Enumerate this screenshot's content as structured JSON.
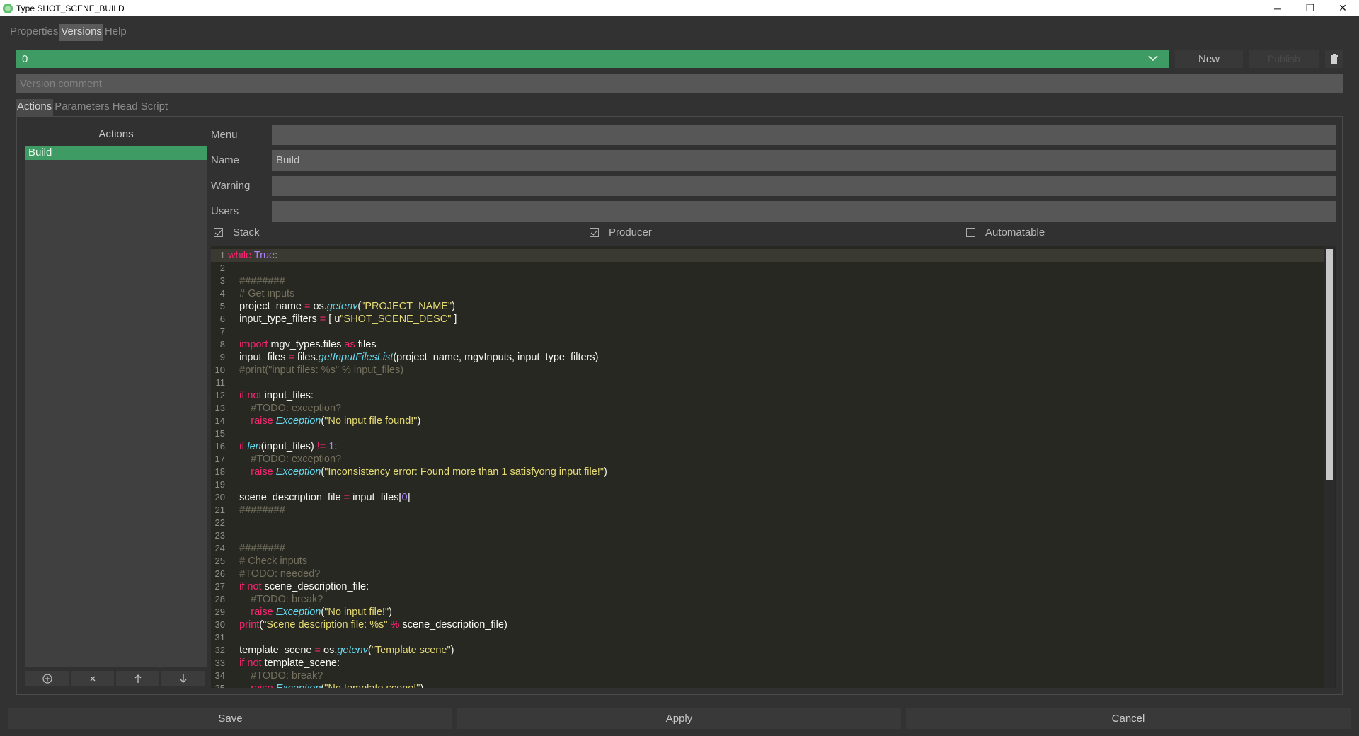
{
  "window": {
    "title": "Type SHOT_SCENE_BUILD",
    "minimize": "─",
    "restore": "❐",
    "close": "✕"
  },
  "menu": [
    {
      "label": "Properties",
      "active": false
    },
    {
      "label": "Versions",
      "active": true
    },
    {
      "label": "Help",
      "active": false
    }
  ],
  "version": {
    "selected": "0",
    "new_label": "New",
    "publish_label": "Publish",
    "comment_placeholder": "Version comment"
  },
  "tabs": [
    {
      "label": "Actions",
      "active": true
    },
    {
      "label": "Parameters",
      "active": false
    },
    {
      "label": "Head Script",
      "active": false
    }
  ],
  "actions": {
    "title": "Actions",
    "items": [
      "Build"
    ],
    "selected": "Build"
  },
  "form": {
    "menu_label": "Menu",
    "menu_value": "",
    "name_label": "Name",
    "name_value": "Build",
    "warning_label": "Warning",
    "warning_value": "",
    "users_label": "Users",
    "users_value": ""
  },
  "checks": {
    "stack": {
      "label": "Stack",
      "checked": true
    },
    "producer": {
      "label": "Producer",
      "checked": true
    },
    "automatable": {
      "label": "Automatable",
      "checked": false
    }
  },
  "code": {
    "current_line": 1,
    "lines": [
      "<span class=\"kw\">while</span> <span class=\"cst\">True</span>:",
      "",
      "    <span class=\"cm\">########</span>",
      "    <span class=\"cm\"># Get inputs</span>",
      "    project_name <span class=\"kw\">=</span> os.<span class=\"fn\">getenv</span>(<span class=\"str\">\"PROJECT_NAME\"</span>)",
      "    input_type_filters <span class=\"kw\">=</span> [ u<span class=\"str\">\"SHOT_SCENE_DESC\"</span> ]",
      "",
      "    <span class=\"kw\">import</span> mgv_types.files <span class=\"kw\">as</span> files",
      "    input_files <span class=\"kw\">=</span> files.<span class=\"fn\">getInputFilesList</span>(project_name, mgvInputs, input_type_filters)",
      "    <span class=\"cm\">#print(\"input files: %s\" % input_files)</span>",
      "",
      "    <span class=\"kw\">if not</span> input_files:",
      "        <span class=\"cm\">#TODO: exception?</span>",
      "        <span class=\"kw\">raise</span> <span class=\"fn\">Exception</span>(<span class=\"str\">\"No input file found!\"</span>)",
      "",
      "    <span class=\"kw\">if</span> <span class=\"fn\">len</span>(input_files) <span class=\"kw\">!=</span> <span class=\"cst\">1</span>:",
      "        <span class=\"cm\">#TODO: exception?</span>",
      "        <span class=\"kw\">raise</span> <span class=\"fn\">Exception</span>(<span class=\"str\">\"Inconsistency error: Found more than 1 satisfyong input file!\"</span>)",
      "",
      "    scene_description_file <span class=\"kw\">=</span> input_files[<span class=\"cst\">0</span>]",
      "    <span class=\"cm\">########</span>",
      "",
      "",
      "    <span class=\"cm\">########</span>",
      "    <span class=\"cm\"># Check inputs</span>",
      "    <span class=\"cm\">#TODO: needed?</span>",
      "    <span class=\"kw\">if not</span> scene_description_file:",
      "        <span class=\"cm\">#TODO: break?</span>",
      "        <span class=\"kw\">raise</span> <span class=\"fn\">Exception</span>(<span class=\"str\">\"No input file!\"</span>)",
      "    <span class=\"kw\">print</span>(<span class=\"str\">\"Scene description file: %s\"</span> <span class=\"kw\">%</span> scene_description_file)",
      "",
      "    template_scene <span class=\"kw\">=</span> os.<span class=\"fn\">getenv</span>(<span class=\"str\">\"Template scene\"</span>)",
      "    <span class=\"kw\">if not</span> template_scene:",
      "        <span class=\"cm\">#TODO: break?</span>",
      "        <span class=\"kw\">raise</span> <span class=\"fn\">Exception</span>(<span class=\"str\">\"No template scene!\"</span>)"
    ]
  },
  "bottom": {
    "save_label": "Save",
    "apply_label": "Apply",
    "cancel_label": "Cancel"
  },
  "colors": {
    "accent_green": "#3d9b63",
    "background": "#323232",
    "editor_bg": "#272822"
  },
  "icons": {
    "add": "add-circle-icon",
    "remove": "close-icon",
    "up": "arrow-up-icon",
    "down": "arrow-down-icon",
    "trash": "trash-icon",
    "dropdown": "chevron-down-icon"
  }
}
